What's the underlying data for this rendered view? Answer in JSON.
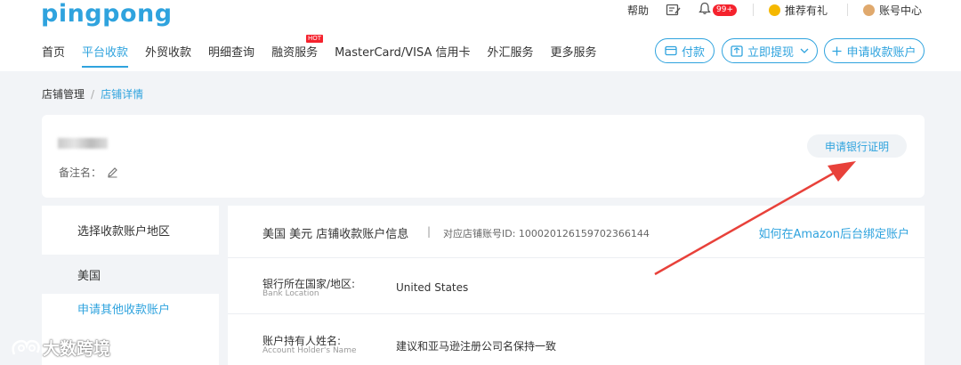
{
  "header": {
    "logo": "pingpong",
    "help": "帮助",
    "notifications_badge": "99+",
    "refer": "推荐有礼",
    "account": "账号中心"
  },
  "nav": [
    {
      "label": "首页",
      "active": false
    },
    {
      "label": "平台收款",
      "active": true
    },
    {
      "label": "外贸收款",
      "active": false
    },
    {
      "label": "明细查询",
      "active": false
    },
    {
      "label": "融资服务",
      "active": false,
      "tag": "HOT"
    },
    {
      "label": "MasterCard/VISA 信用卡",
      "active": false
    },
    {
      "label": "外汇服务",
      "active": false
    },
    {
      "label": "更多服务",
      "active": false
    }
  ],
  "actions": {
    "pay": "付款",
    "withdraw": "立即提现",
    "apply_account": "申请收款账户"
  },
  "breadcrumb": {
    "parent": "店铺管理",
    "current": "店铺详情"
  },
  "store": {
    "remark_label": "备注名：",
    "bank_certificate": "申请银行证明"
  },
  "side": {
    "title": "选择收款账户地区",
    "region": "美国",
    "other": "申请其他收款账户"
  },
  "account_info": {
    "title": "美国 美元 店铺收款账户信息",
    "sep": "|",
    "store_id_label": "对应店铺账号ID: 1000201261597023661​44",
    "help_link": "如何在Amazon后台绑定账户",
    "rows": [
      {
        "label": "银行所在国家/地区:",
        "label_en": "Bank Location",
        "value": "United States"
      },
      {
        "label": "账户持有人姓名:",
        "label_en": "Account Holder's Name",
        "value": "建议和亚马逊注册公司名保持一致"
      }
    ]
  },
  "watermark": "大数跨境",
  "colors": {
    "accent": "#2fa3de",
    "badge": "#f5222d",
    "arrow": "#e8413a"
  }
}
